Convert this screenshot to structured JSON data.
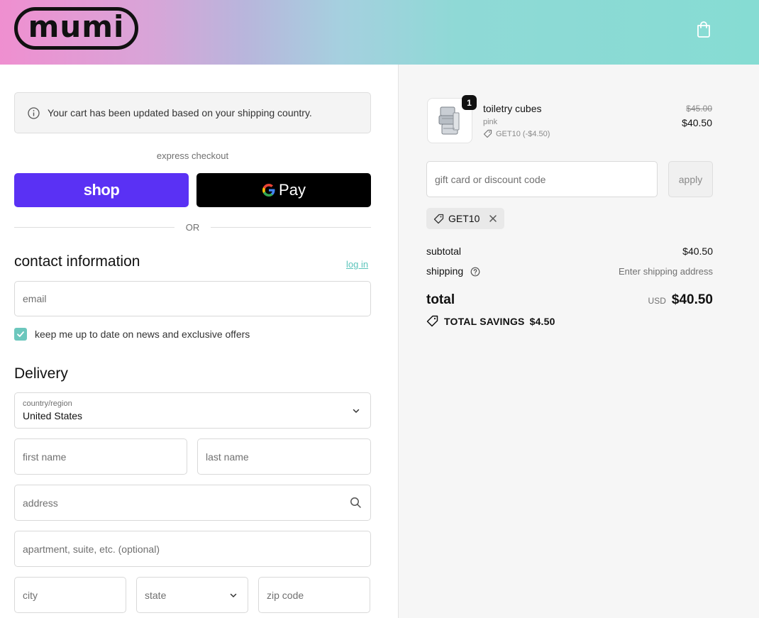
{
  "brand": {
    "logo_text": "mumi"
  },
  "header": {
    "cart_icon": "shopping-bag-icon"
  },
  "notice": {
    "text": "Your cart has been updated based on your shipping country.",
    "icon": "info-icon"
  },
  "express": {
    "label": "express checkout",
    "shop_label": "shop",
    "gpay_label": "Pay",
    "shop_color": "#5a31f4"
  },
  "divider": {
    "or": "OR"
  },
  "contact": {
    "title": "contact information",
    "login_label": "log in",
    "email_placeholder": "email",
    "newsletter_label": "keep me up to date on news and exclusive offers",
    "newsletter_checked": true
  },
  "delivery": {
    "title": "Delivery",
    "country_label": "country/region",
    "country_value": "United States",
    "first_name_placeholder": "first name",
    "last_name_placeholder": "last name",
    "address_placeholder": "address",
    "apartment_placeholder": "apartment, suite, etc. (optional)",
    "city_placeholder": "city",
    "state_placeholder": "state",
    "zip_placeholder": "zip code"
  },
  "order": {
    "item": {
      "quantity": "1",
      "name": "toiletry cubes",
      "variant": "pink",
      "discount": "GET10 (-$4.50)",
      "original_price": "$45.00",
      "price": "$40.50"
    },
    "discount_placeholder": "gift card or discount code",
    "apply_label": "apply",
    "applied_code": "GET10",
    "subtotal_label": "subtotal",
    "subtotal_value": "$40.50",
    "shipping_label": "shipping",
    "shipping_value": "Enter shipping address",
    "total_label": "total",
    "currency": "USD",
    "total_value": "$40.50",
    "savings_label": "TOTAL SAVINGS",
    "savings_value": "$4.50"
  },
  "colors": {
    "accent": "#6cc7bd",
    "link": "#5bc4bb"
  }
}
